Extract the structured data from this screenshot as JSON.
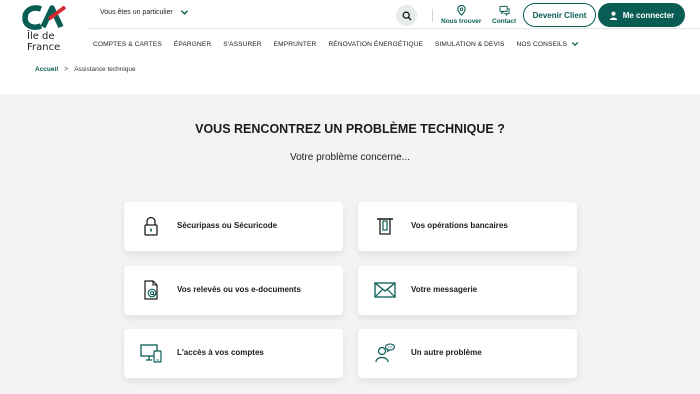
{
  "brand": {
    "line1": "Île de",
    "line2": "France",
    "color_red": "#d8282f",
    "color_green": "#0a5d55"
  },
  "header": {
    "profile_label": "Vous êtes un particulier",
    "search_icon": "search-icon",
    "quick_links": [
      {
        "label": "Nous trouver",
        "icon": "map-pin-icon"
      },
      {
        "label": "Contact",
        "icon": "chat-icon"
      }
    ],
    "become_client": "Devenir Client",
    "login": "Me connecter"
  },
  "nav": {
    "items": [
      "COMPTES & CARTES",
      "ÉPARGNER",
      "S'ASSURER",
      "EMPRUNTER",
      "RÉNOVATION ÉNERGÉTIQUE",
      "SIMULATION & DEVIS",
      "NOS CONSEILS"
    ]
  },
  "breadcrumb": {
    "home": "Accueil",
    "separator": ">",
    "current": "Assistance technique"
  },
  "main": {
    "title": "VOUS RENCONTREZ UN PROBLÈME TECHNIQUE ?",
    "subtitle": "Votre problème concerne...",
    "cards": [
      {
        "label": "Sécuripass ou Sécuricode",
        "icon": "lock-icon"
      },
      {
        "label": "Vos opérations bancaires",
        "icon": "atm-icon"
      },
      {
        "label": "Vos relevés ou vos e-documents",
        "icon": "e-document-icon"
      },
      {
        "label": "Votre messagerie",
        "icon": "envelope-icon"
      },
      {
        "label": "L'accès à vos comptes",
        "icon": "devices-icon"
      },
      {
        "label": "Un autre problème",
        "icon": "support-person-icon"
      }
    ]
  }
}
